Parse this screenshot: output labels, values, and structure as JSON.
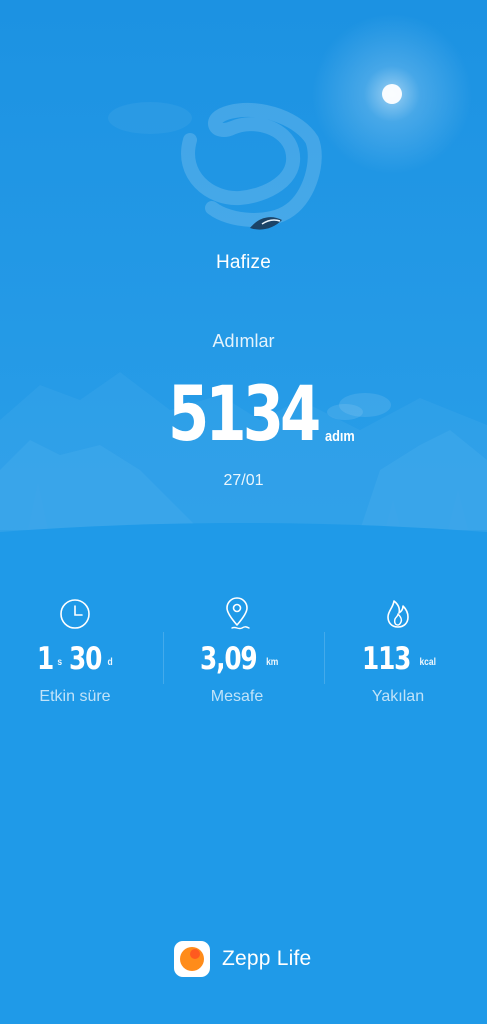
{
  "header": {
    "user_name": "Hafize"
  },
  "steps": {
    "label": "Adımlar",
    "value": "5134",
    "unit": "adım",
    "date": "27/01"
  },
  "stats": [
    {
      "icon": "clock-icon",
      "hours": "1",
      "hours_unit": "s",
      "minutes": "30",
      "minutes_unit": "d",
      "label": "Etkin süre"
    },
    {
      "icon": "location-pin-icon",
      "value": "3,09",
      "unit": "km",
      "label": "Mesafe"
    },
    {
      "icon": "flame-icon",
      "value": "113",
      "unit": "kcal",
      "label": "Yakılan"
    }
  ],
  "footer": {
    "app_name": "Zepp Life"
  },
  "colors": {
    "background": "#1f9ae8",
    "sky_top": "#1e95e4",
    "mountain": "#3aa6ea",
    "logo_orange": "#ff8c1a"
  }
}
